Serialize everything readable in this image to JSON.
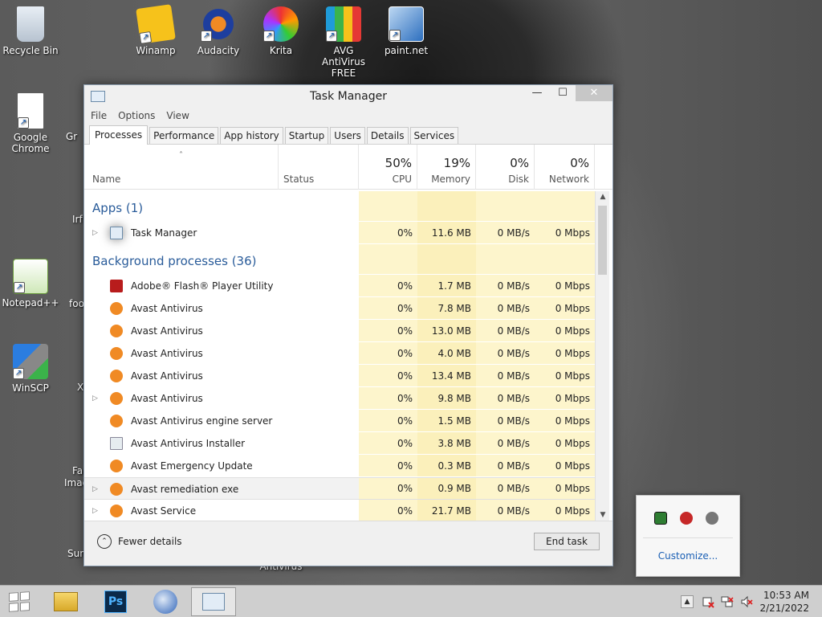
{
  "desktop": {
    "icons": [
      {
        "label": "Recycle Bin"
      },
      {
        "label": "Winamp"
      },
      {
        "label": "Audacity"
      },
      {
        "label": "Krita"
      },
      {
        "label": "AVG AntiVirus FREE"
      },
      {
        "label": "paint.net"
      },
      {
        "label": "Google Chrome"
      },
      {
        "label": "Notepad++"
      },
      {
        "label": "WinSCP"
      }
    ],
    "partial_labels": [
      "Gr",
      "Irf",
      "foo",
      "X",
      "Fa",
      "Imag",
      "Sum",
      "Antivirus"
    ]
  },
  "taskmanager": {
    "title": "Task Manager",
    "window_buttons": {
      "minimize": "—",
      "maximize": "☐",
      "close": "✕"
    },
    "menu": [
      "File",
      "Options",
      "View"
    ],
    "tabs": [
      "Processes",
      "Performance",
      "App history",
      "Startup",
      "Users",
      "Details",
      "Services"
    ],
    "active_tab": "Processes",
    "columns": {
      "name": "Name",
      "status": "Status",
      "cpu": {
        "pct": "50%",
        "label": "CPU"
      },
      "memory": {
        "pct": "19%",
        "label": "Memory"
      },
      "disk": {
        "pct": "0%",
        "label": "Disk"
      },
      "network": {
        "pct": "0%",
        "label": "Network"
      }
    },
    "groups": {
      "apps": "Apps (1)",
      "background": "Background processes (36)"
    },
    "apps": [
      {
        "name": "Task Manager",
        "cpu": "0%",
        "memory": "11.6 MB",
        "disk": "0 MB/s",
        "network": "0 Mbps",
        "icon": "taskmanager-icon",
        "expandable": true
      }
    ],
    "background": [
      {
        "name": "Adobe® Flash® Player Utility",
        "cpu": "0%",
        "memory": "1.7 MB",
        "disk": "0 MB/s",
        "network": "0 Mbps",
        "icon": "flash-icon",
        "expandable": false
      },
      {
        "name": "Avast Antivirus",
        "cpu": "0%",
        "memory": "7.8 MB",
        "disk": "0 MB/s",
        "network": "0 Mbps",
        "icon": "avast-icon",
        "expandable": false
      },
      {
        "name": "Avast Antivirus",
        "cpu": "0%",
        "memory": "13.0 MB",
        "disk": "0 MB/s",
        "network": "0 Mbps",
        "icon": "avast-icon",
        "expandable": false
      },
      {
        "name": "Avast Antivirus",
        "cpu": "0%",
        "memory": "4.0 MB",
        "disk": "0 MB/s",
        "network": "0 Mbps",
        "icon": "avast-icon",
        "expandable": false
      },
      {
        "name": "Avast Antivirus",
        "cpu": "0%",
        "memory": "13.4 MB",
        "disk": "0 MB/s",
        "network": "0 Mbps",
        "icon": "avast-icon",
        "expandable": false
      },
      {
        "name": "Avast Antivirus",
        "cpu": "0%",
        "memory": "9.8 MB",
        "disk": "0 MB/s",
        "network": "0 Mbps",
        "icon": "avast-icon",
        "expandable": true
      },
      {
        "name": "Avast Antivirus engine server",
        "cpu": "0%",
        "memory": "1.5 MB",
        "disk": "0 MB/s",
        "network": "0 Mbps",
        "icon": "avast-icon",
        "expandable": false
      },
      {
        "name": "Avast Antivirus Installer",
        "cpu": "0%",
        "memory": "3.8 MB",
        "disk": "0 MB/s",
        "network": "0 Mbps",
        "icon": "installer-icon",
        "expandable": false
      },
      {
        "name": "Avast Emergency Update",
        "cpu": "0%",
        "memory": "0.3 MB",
        "disk": "0 MB/s",
        "network": "0 Mbps",
        "icon": "avast-icon",
        "expandable": false
      },
      {
        "name": "Avast remediation exe",
        "cpu": "0%",
        "memory": "0.9 MB",
        "disk": "0 MB/s",
        "network": "0 Mbps",
        "icon": "avast-icon",
        "expandable": true,
        "highlighted": true
      },
      {
        "name": "Avast Service",
        "cpu": "0%",
        "memory": "21.7 MB",
        "disk": "0 MB/s",
        "network": "0 Mbps",
        "icon": "avast-icon",
        "expandable": true
      }
    ],
    "footer": {
      "fewer_details": "Fewer details",
      "end_task": "End task"
    }
  },
  "tray_popup": {
    "customize": "Customize..."
  },
  "taskbar": {
    "time": "10:53 AM",
    "date": "2/21/2022",
    "pinned": [
      "start-icon",
      "file-explorer-icon",
      "photoshop-icon",
      "thunderbird-icon",
      "taskmanager-icon"
    ],
    "photoshop_label": "Ps"
  },
  "colors": {
    "accent_blue": "#2a5c9a",
    "heat_light": "#fdf5cc",
    "heat_mid": "#fbf0bb",
    "avast_orange": "#f08a24"
  }
}
